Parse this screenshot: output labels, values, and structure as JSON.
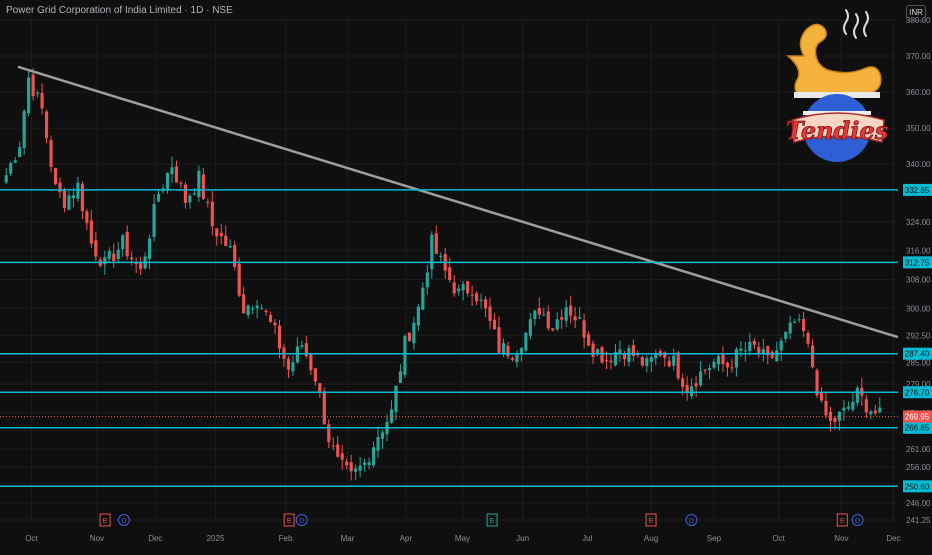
{
  "header": {
    "title": "Power Grid Corporation of India Limited · 1D · NSE",
    "currency": "INR"
  },
  "logo": {
    "text": "Tendies"
  },
  "colors": {
    "background": "#0f0f0f",
    "up": "#26a69a",
    "down": "#ef5350",
    "hline": "#00bcd4",
    "trendline": "#9e9e9e",
    "grid": "#1c1c1c",
    "axis_text": "#8a8e98"
  },
  "chart_data": {
    "type": "candlestick",
    "title": "Power Grid Corporation of India Limited · 1D · NSE",
    "ylim": [
      241.25,
      380.0
    ],
    "x_range": [
      "2024-09-23",
      "2024-12-06"
    ],
    "grid": true,
    "y_ticks": [
      241.25,
      246.0,
      251.0,
      256.0,
      261.0,
      266.0,
      271.0,
      279.0,
      285.0,
      292.5,
      300.0,
      308.0,
      316.0,
      324.0,
      340.0,
      350.0,
      360.0,
      370.0,
      380.0
    ],
    "x_ticks": [
      {
        "label": "Oct",
        "pos": 0.035
      },
      {
        "label": "Nov",
        "pos": 0.108
      },
      {
        "label": "Dec",
        "pos": 0.173
      },
      {
        "label": "2025",
        "pos": 0.24
      },
      {
        "label": "Feb",
        "pos": 0.318
      },
      {
        "label": "Mar",
        "pos": 0.387
      },
      {
        "label": "Apr",
        "pos": 0.452
      },
      {
        "label": "May",
        "pos": 0.515
      },
      {
        "label": "Jun",
        "pos": 0.582
      },
      {
        "label": "Jul",
        "pos": 0.654
      },
      {
        "label": "Aug",
        "pos": 0.725
      },
      {
        "label": "Sep",
        "pos": 0.795
      },
      {
        "label": "Oct",
        "pos": 0.867
      },
      {
        "label": "Nov",
        "pos": 0.937
      },
      {
        "label": "Dec",
        "pos": 0.995
      }
    ],
    "horizontal_lines": [
      {
        "price": 332.85,
        "label": "332.85"
      },
      {
        "price": 312.75,
        "label": "312.75"
      },
      {
        "price": 287.4,
        "label": "287.40"
      },
      {
        "price": 276.7,
        "label": "276.70"
      },
      {
        "price": 266.85,
        "label": "266.85"
      },
      {
        "price": 250.6,
        "label": "250.60"
      }
    ],
    "last_price": {
      "price": 269.95,
      "label": "269.95"
    },
    "trendline": {
      "start": [
        0.02,
        367.0
      ],
      "end": [
        1.0,
        292.0
      ]
    },
    "events": [
      {
        "pos": 0.117,
        "letter": "E",
        "kind": "earnings"
      },
      {
        "pos": 0.138,
        "letter": "D",
        "kind": "dividend"
      },
      {
        "pos": 0.322,
        "letter": "E",
        "kind": "earnings"
      },
      {
        "pos": 0.336,
        "letter": "D",
        "kind": "dividend"
      },
      {
        "pos": 0.548,
        "letter": "E",
        "kind": "split"
      },
      {
        "pos": 0.725,
        "letter": "E",
        "kind": "earnings"
      },
      {
        "pos": 0.77,
        "letter": "D",
        "kind": "dividend"
      },
      {
        "pos": 0.938,
        "letter": "E",
        "kind": "earnings"
      },
      {
        "pos": 0.955,
        "letter": "D",
        "kind": "dividend"
      }
    ],
    "anchors": [
      [
        0,
        337
      ],
      [
        3,
        346
      ],
      [
        5,
        364
      ],
      [
        8,
        355
      ],
      [
        11,
        333
      ],
      [
        13,
        330
      ],
      [
        16,
        334
      ],
      [
        19,
        318
      ],
      [
        22,
        312
      ],
      [
        26,
        318
      ],
      [
        30,
        310
      ],
      [
        34,
        332
      ],
      [
        37,
        340
      ],
      [
        40,
        330
      ],
      [
        43,
        336
      ],
      [
        46,
        323
      ],
      [
        50,
        316
      ],
      [
        53,
        300
      ],
      [
        56,
        303
      ],
      [
        60,
        293
      ],
      [
        63,
        283
      ],
      [
        66,
        290
      ],
      [
        69,
        281
      ],
      [
        72,
        264
      ],
      [
        74,
        257
      ],
      [
        77,
        253
      ],
      [
        80,
        257
      ],
      [
        83,
        265
      ],
      [
        86,
        271
      ],
      [
        89,
        290
      ],
      [
        92,
        300
      ],
      [
        95,
        318
      ],
      [
        98,
        310
      ],
      [
        101,
        304
      ],
      [
        104,
        306
      ],
      [
        107,
        299
      ],
      [
        110,
        289
      ],
      [
        113,
        288
      ],
      [
        116,
        293
      ],
      [
        119,
        300
      ],
      [
        122,
        295
      ],
      [
        125,
        301
      ],
      [
        128,
        296
      ],
      [
        131,
        289
      ],
      [
        134,
        286
      ],
      [
        137,
        289
      ],
      [
        140,
        287
      ],
      [
        143,
        284
      ],
      [
        146,
        288
      ],
      [
        149,
        285
      ],
      [
        152,
        278
      ],
      [
        155,
        282
      ],
      [
        158,
        285
      ],
      [
        161,
        284
      ],
      [
        164,
        288
      ],
      [
        167,
        289
      ],
      [
        170,
        285
      ],
      [
        173,
        290
      ],
      [
        176,
        296
      ],
      [
        178,
        293
      ],
      [
        180,
        284
      ],
      [
        182,
        272
      ],
      [
        184,
        268
      ],
      [
        187,
        271
      ],
      [
        190,
        276
      ],
      [
        193,
        272
      ],
      [
        195,
        270
      ]
    ]
  }
}
